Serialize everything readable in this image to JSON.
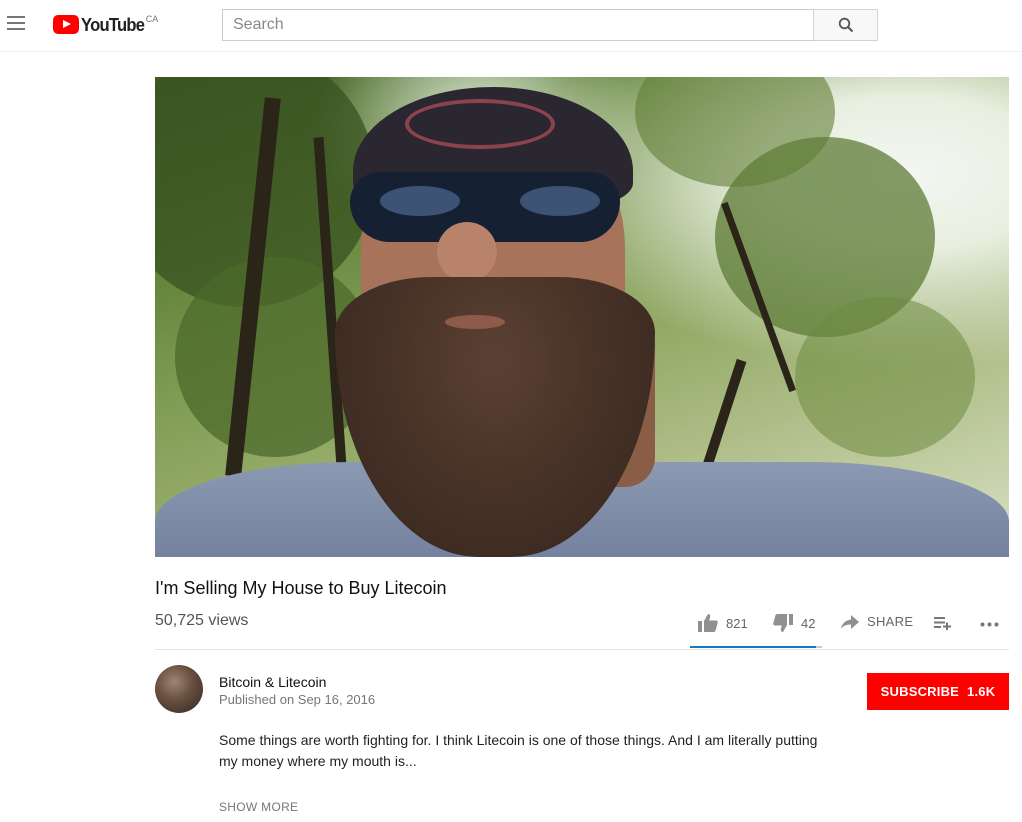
{
  "header": {
    "logo_text": "YouTube",
    "region": "CA",
    "search_placeholder": "Search"
  },
  "video": {
    "title": "I'm Selling My House to Buy Litecoin",
    "views": "50,725 views",
    "likes": "821",
    "dislikes": "42",
    "share_label": "SHARE",
    "like_ratio": 0.951
  },
  "owner": {
    "channel_name": "Bitcoin & Litecoin",
    "published": "Published on Sep 16, 2016",
    "subscribe_label": "SUBSCRIBE",
    "subscriber_count": "1.6K"
  },
  "description": {
    "text": "Some things are worth fighting for.  I think Litecoin is one of those things.  And I am literally putting my money where my mouth is...",
    "show_more": "SHOW MORE"
  },
  "colors": {
    "brand_red": "#ff0000",
    "sentiment_blue": "#167ac6"
  }
}
